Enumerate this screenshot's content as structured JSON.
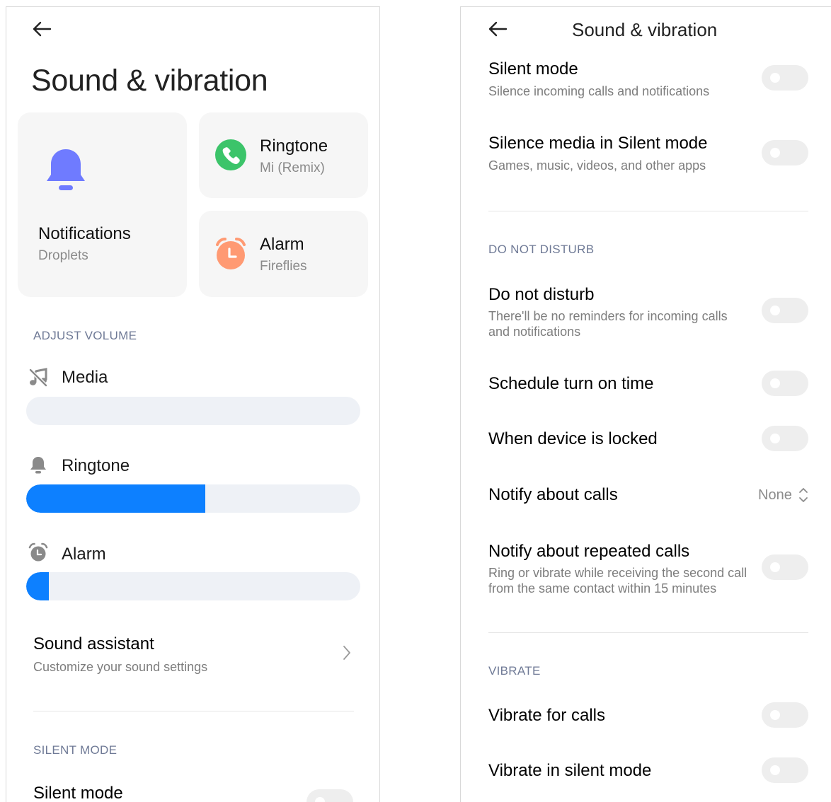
{
  "left": {
    "title": "Sound & vibration",
    "cards": {
      "notifications": {
        "title": "Notifications",
        "subtitle": "Droplets",
        "icon": "bell-icon",
        "color": "#6f7bff"
      },
      "ringtone": {
        "title": "Ringtone",
        "subtitle": "Mi (Remix)",
        "icon": "phone-icon",
        "color": "#3cc46a"
      },
      "alarm": {
        "title": "Alarm",
        "subtitle": "Fireflies",
        "icon": "alarm-clock-icon",
        "color": "#ff9a73"
      }
    },
    "adjust_volume_header": "ADJUST VOLUME",
    "volumes": {
      "media": {
        "label": "Media",
        "icon": "music-off-icon",
        "level": 0.0
      },
      "ringtone": {
        "label": "Ringtone",
        "icon": "bell-icon",
        "level": 0.535
      },
      "alarm": {
        "label": "Alarm",
        "icon": "alarm-clock-icon",
        "level": 0.067
      }
    },
    "sound_assistant": {
      "title": "Sound assistant",
      "subtitle": "Customize your sound settings"
    },
    "silent_mode_header": "SILENT MODE",
    "silent_mode_title": "Silent mode"
  },
  "right": {
    "title": "Sound & vibration",
    "silent_mode": {
      "title": "Silent mode",
      "subtitle": "Silence incoming calls and notifications",
      "on": false
    },
    "silence_media": {
      "title": "Silence media in Silent mode",
      "subtitle": "Games, music, videos, and other apps",
      "on": false
    },
    "dnd_header": "DO NOT DISTURB",
    "dnd": {
      "title": "Do not disturb",
      "subtitle_line1": "There'll be no reminders for incoming calls",
      "subtitle_line2": "and notifications",
      "on": false
    },
    "schedule": {
      "title": "Schedule turn on time",
      "on": false
    },
    "when_locked": {
      "title": "When device is locked",
      "on": false
    },
    "notify_calls": {
      "title": "Notify about calls",
      "value": "None"
    },
    "repeated_calls": {
      "title": "Notify about repeated calls",
      "subtitle_line1": "Ring or vibrate while receiving the second call",
      "subtitle_line2": "from the same contact within 15 minutes",
      "on": false
    },
    "vibrate_header": "VIBRATE",
    "vibrate_calls": {
      "title": "Vibrate for calls",
      "on": false
    },
    "vibrate_silent": {
      "title": "Vibrate in silent mode",
      "on": false
    }
  },
  "colors": {
    "accent": "#0d80ff",
    "track": "#eef1f6",
    "toggle_off": "#eeeeee",
    "section": "#6f7a96"
  }
}
